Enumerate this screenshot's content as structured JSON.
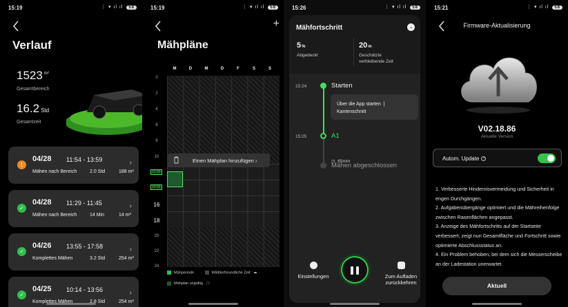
{
  "p1": {
    "status": {
      "time": "15:19",
      "battery": "58"
    },
    "title": "Verlauf",
    "total_area": {
      "value": "1523",
      "unit": "m²",
      "label": "Gesamtbereich"
    },
    "total_time": {
      "value": "16.2",
      "unit": "Std",
      "label": "Gesamtzeit"
    },
    "records": [
      {
        "date": "04/28",
        "time": "11:54 - 13:59",
        "mode": "Mähen nach Bereich",
        "duration": "2.0 Std",
        "area": "188 m²",
        "status": "warning"
      },
      {
        "date": "04/28",
        "time": "11:29 - 11:45",
        "mode": "Mähen nach Bereich",
        "duration": "14 Min",
        "area": "14 m²",
        "status": "done"
      },
      {
        "date": "04/26",
        "time": "13:55 - 17:58",
        "mode": "Komplettes Mähen",
        "duration": "3.2 Std",
        "area": "254 m²",
        "status": "done"
      },
      {
        "date": "04/25",
        "time": "10:14 - 13:56",
        "mode": "Komplettes Mähen",
        "duration": "2.8 Std",
        "area": "254 m²",
        "status": "done"
      }
    ]
  },
  "p2": {
    "status": {
      "time": "15:19",
      "battery": "58"
    },
    "title": "Mähpläne",
    "days": [
      "M",
      "D",
      "M",
      "D",
      "F",
      "S",
      "S"
    ],
    "hours": [
      "0",
      "2",
      "4",
      "6",
      "8",
      "10",
      "12",
      "14",
      "16",
      "18",
      "20",
      "22",
      "24"
    ],
    "tooltip": "Einen Mähplan hinzufügen",
    "tag_start": "12:00",
    "tag_end": "14:00",
    "legend": {
      "period": "Mähperiode",
      "wildlife": "Wildtierfreundliche Zeit",
      "invalid": "Mähplan ungültig"
    }
  },
  "p3": {
    "status": {
      "time": "15:26",
      "battery": "58"
    },
    "title": "Mähfortschritt",
    "covered": {
      "value": "5",
      "unit": "%",
      "label": "Abgedeckt"
    },
    "remaining": {
      "value": "20",
      "unit": "m",
      "label_1": "Geschätzte",
      "label_2": "verbleibende Zeit"
    },
    "events": [
      {
        "time": "15:24",
        "label": "Starten"
      },
      {
        "time": "15:25",
        "label": "A1"
      },
      {
        "time": "",
        "label": "Mähen abgeschlossen"
      }
    ],
    "detail": {
      "line1": "Über die App starten",
      "line2": "Kantenschnitt"
    },
    "height": "65mm",
    "settings": "Einstellungen",
    "return_1": "Zum Aufladen",
    "return_2": "zurückkehren"
  },
  "p4": {
    "status": {
      "time": "15:21",
      "battery": "58"
    },
    "title": "Firmware-Aktualisierung",
    "version": "V02.18.86",
    "version_caption": "Aktuelle Version",
    "auto_update": "Autom. Update",
    "auto_update_on": true,
    "notes": [
      "1. Verbesserte Hindernisvermeidung und Sicherheit in engen Durchgängen.",
      "2. Aufgabenübergänge optimiert und die Mähreihenfolge zwischen Rasenflächen angepasst.",
      "3. Anzeige des Mähfortschritts auf der Startseite verbessert; zeigt nun Gesamtfläche und Fortschritt sowie optimierte Abschlussstatus an.",
      "4. Ein Problem behoben, bei dem sich die Messerscheibe an der Ladestation unerwartet"
    ],
    "button": "Aktuell"
  },
  "colors": {
    "accent": "#3fe05a",
    "warning": "#f08a24",
    "card": "#2c2c2c"
  }
}
